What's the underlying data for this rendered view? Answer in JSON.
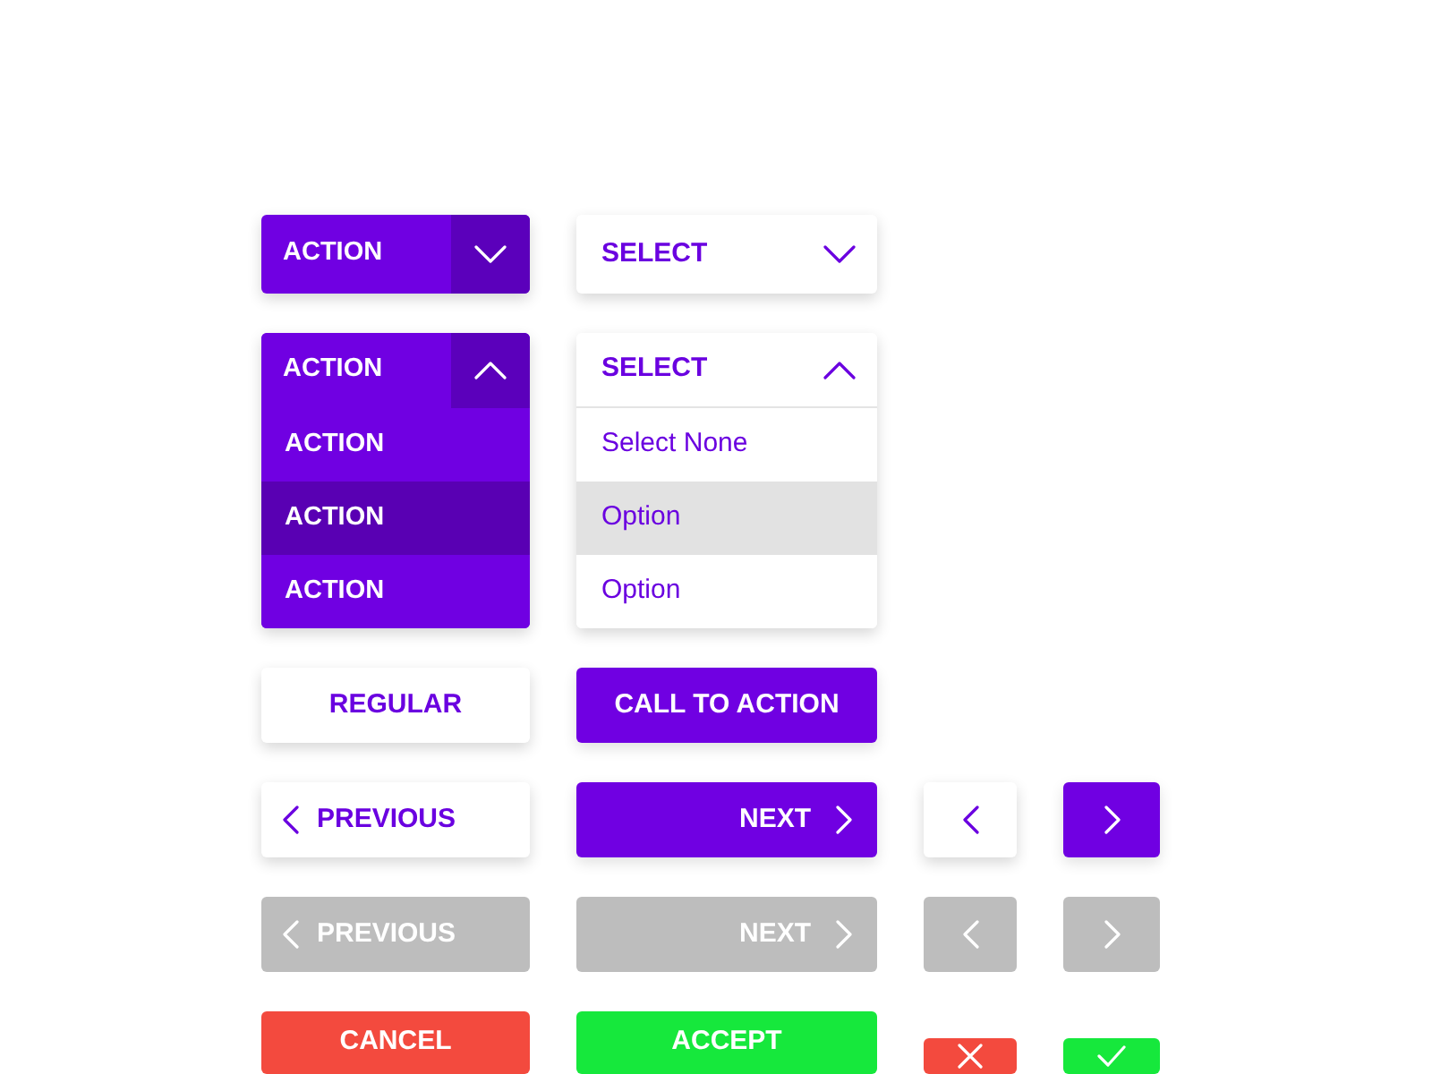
{
  "dropdown_rows": [
    [
      {
        "kind": "action",
        "label": "ACTION",
        "expanded": false
      },
      {
        "kind": "select",
        "label": "SELECT",
        "expanded": false
      }
    ],
    [
      {
        "kind": "action",
        "label": "ACTION",
        "expanded": true,
        "items": [
          {
            "label": "ACTION",
            "selected": false
          },
          {
            "label": "ACTION",
            "selected": true
          },
          {
            "label": "ACTION",
            "selected": false
          }
        ]
      },
      {
        "kind": "select",
        "label": "SELECT",
        "expanded": true,
        "items": [
          {
            "label": "Select None",
            "selected": false
          },
          {
            "label": "Option",
            "selected": true
          },
          {
            "label": "Option",
            "selected": false
          }
        ]
      }
    ]
  ],
  "button_rows": [
    [
      {
        "kind": "regular",
        "label": "REGULAR",
        "disabled": false
      },
      {
        "kind": "primary",
        "label": "CALL TO ACTION",
        "disabled": false
      }
    ],
    [
      {
        "kind": "previous",
        "label": "PREVIOUS",
        "disabled": false
      },
      {
        "kind": "next",
        "label": "NEXT",
        "disabled": false
      },
      {
        "kind": "icon_previous",
        "disabled": false
      },
      {
        "kind": "icon_next",
        "disabled": false
      }
    ],
    [
      {
        "kind": "previous",
        "label": "PREVIOUS",
        "disabled": true
      },
      {
        "kind": "next",
        "label": "NEXT",
        "disabled": true
      },
      {
        "kind": "icon_previous",
        "disabled": true
      },
      {
        "kind": "icon_next",
        "disabled": true
      }
    ],
    [
      {
        "kind": "cancel",
        "label": "CANCEL",
        "disabled": false
      },
      {
        "kind": "accept",
        "label": "ACCEPT",
        "disabled": false
      },
      {
        "kind": "icon_cancel",
        "disabled": false
      },
      {
        "kind": "icon_accept",
        "disabled": false
      }
    ]
  ]
}
